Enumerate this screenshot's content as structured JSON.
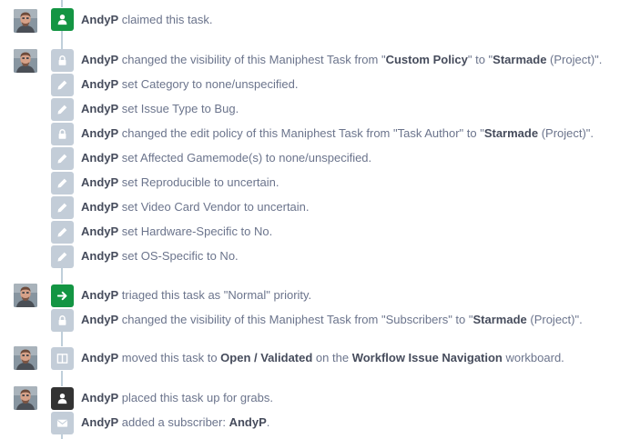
{
  "user": "AndyP",
  "groups": [
    {
      "events": [
        {
          "icon": "user-icon",
          "parts": [
            {
              "t": " claimed this task."
            }
          ]
        }
      ]
    },
    {
      "events": [
        {
          "icon": "lock-icon",
          "parts": [
            {
              "t": " changed the visibility of this Maniphest Task from \""
            },
            {
              "b": "Custom Policy"
            },
            {
              "t": "\" to \""
            },
            {
              "b": "Starmade"
            },
            {
              "t": " (Project)\"."
            }
          ]
        },
        {
          "icon": "pencil-icon",
          "parts": [
            {
              "t": " set Category to none/unspecified."
            }
          ]
        },
        {
          "icon": "pencil-icon",
          "parts": [
            {
              "t": " set Issue Type to Bug."
            }
          ]
        },
        {
          "icon": "lock-icon",
          "parts": [
            {
              "t": " changed the edit policy of this Maniphest Task from \"Task Author\" to \""
            },
            {
              "b": "Starmade"
            },
            {
              "t": " (Project)\"."
            }
          ]
        },
        {
          "icon": "pencil-icon",
          "parts": [
            {
              "t": " set Affected Gamemode(s) to none/unspecified."
            }
          ]
        },
        {
          "icon": "pencil-icon",
          "parts": [
            {
              "t": " set Reproducible to uncertain."
            }
          ]
        },
        {
          "icon": "pencil-icon",
          "parts": [
            {
              "t": " set Video Card Vendor to uncertain."
            }
          ]
        },
        {
          "icon": "pencil-icon",
          "parts": [
            {
              "t": " set Hardware-Specific to No."
            }
          ]
        },
        {
          "icon": "pencil-icon",
          "parts": [
            {
              "t": " set OS-Specific to No."
            }
          ]
        }
      ]
    },
    {
      "events": [
        {
          "icon": "arrow-right-icon",
          "parts": [
            {
              "t": " triaged this task as \"Normal\" priority."
            }
          ]
        },
        {
          "icon": "lock-icon",
          "parts": [
            {
              "t": " changed the visibility of this Maniphest Task from \"Subscribers\" to \""
            },
            {
              "b": "Starmade"
            },
            {
              "t": " (Project)\"."
            }
          ]
        }
      ]
    },
    {
      "events": [
        {
          "icon": "columns-icon",
          "parts": [
            {
              "t": " moved this task to "
            },
            {
              "b": "Open / Validated"
            },
            {
              "t": " on the "
            },
            {
              "b": "Workflow Issue Navigation"
            },
            {
              "t": " workboard."
            }
          ]
        }
      ]
    },
    {
      "events": [
        {
          "icon": "user-icon",
          "parts": [
            {
              "t": " placed this task up for grabs."
            }
          ]
        },
        {
          "icon": "envelope-icon",
          "parts": [
            {
              "t": " added a subscriber: "
            },
            {
              "b": "AndyP"
            },
            {
              "t": "."
            }
          ]
        }
      ]
    }
  ],
  "colors": {
    "accent_green": "#139543",
    "dark_icon": "#333333",
    "muted_icon": "#c3cdd8",
    "rail": "#bfcfda"
  }
}
